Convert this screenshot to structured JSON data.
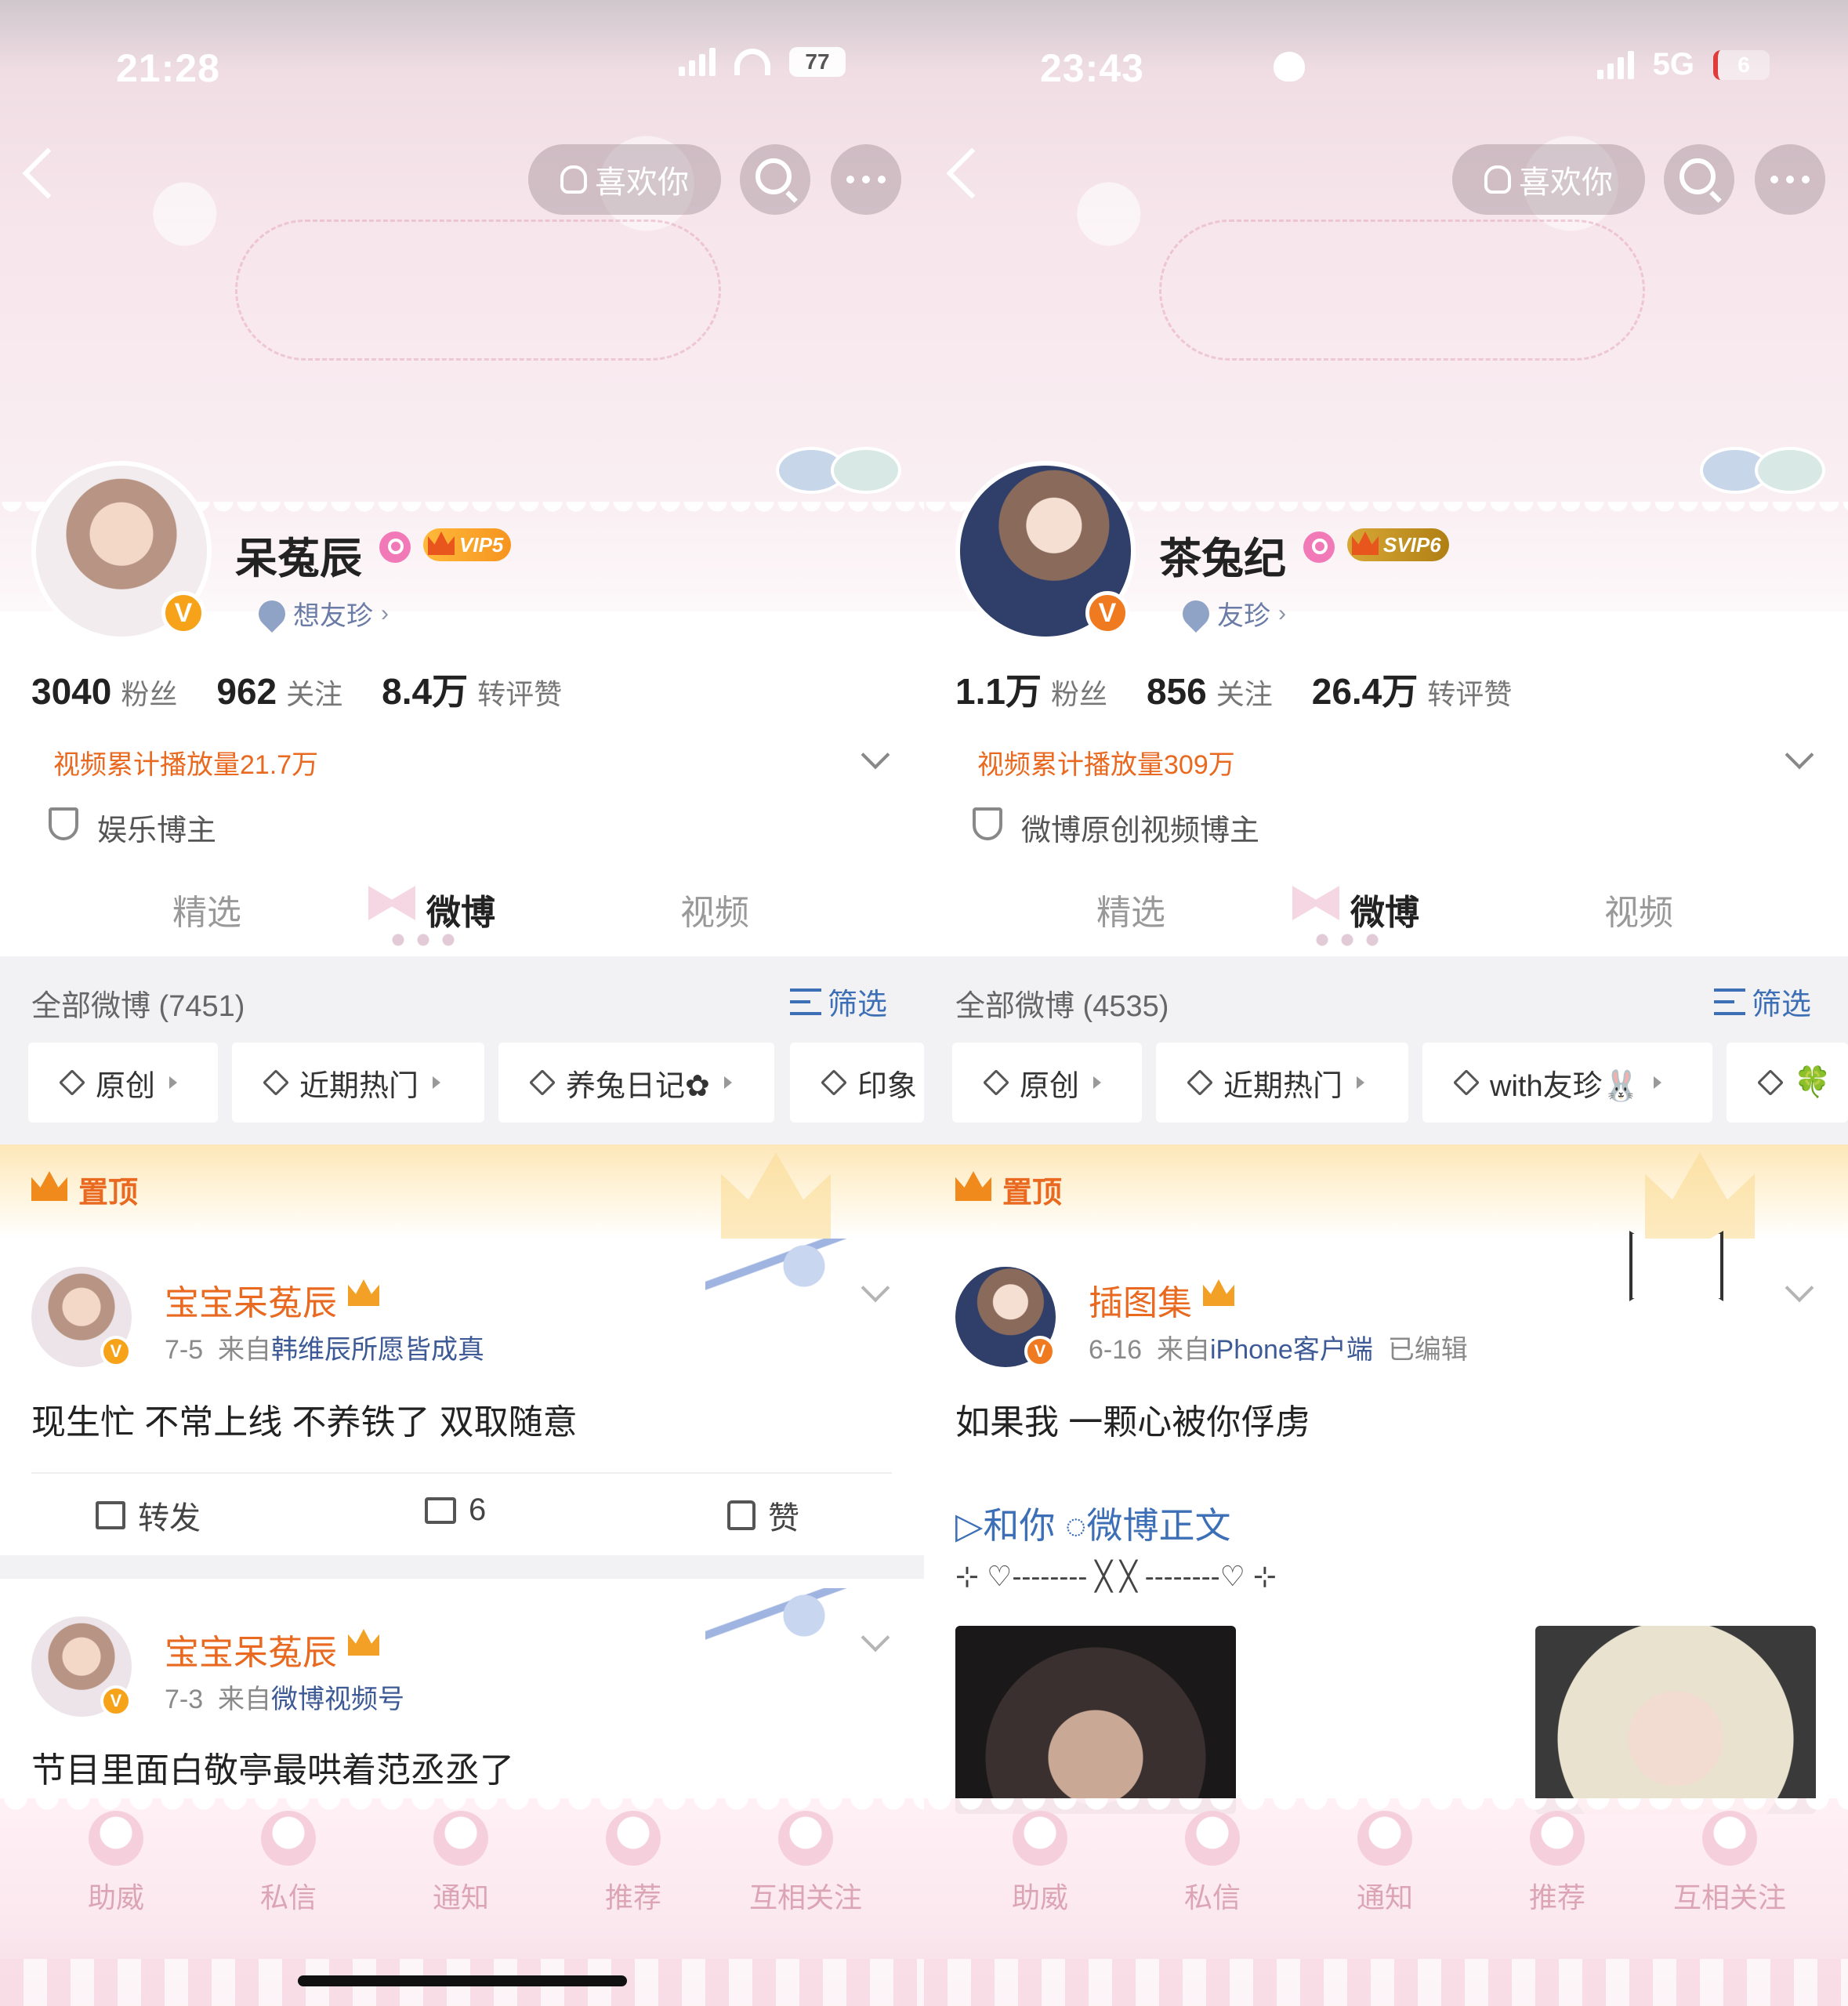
{
  "left": {
    "status": {
      "time": "21:28",
      "battery": "77"
    },
    "like_button": "喜欢你",
    "profile": {
      "name": "呆菟辰",
      "vip_label": "VIP5",
      "friend_label": "想友珍",
      "stats": [
        {
          "num": "3040",
          "label": "粉丝"
        },
        {
          "num": "962",
          "label": "关注"
        },
        {
          "num": "8.4万",
          "label": "转评赞"
        }
      ],
      "plays": "视频累计播放量21.7万",
      "role": "娱乐博主"
    },
    "tabs": [
      "精选",
      "微博",
      "视频"
    ],
    "all_count": "全部微博 (7451)",
    "filter_label": "筛选",
    "chips": [
      "原创",
      "近期热门",
      "养兔日记✿",
      "印象"
    ],
    "pinned_label": "置顶",
    "posts": [
      {
        "author": "宝宝呆菟辰",
        "date": "7-5",
        "from": "来自",
        "source": "韩维辰所愿皆成真",
        "text": "现生忙 不常上线 不养铁了 双取随意",
        "actions": {
          "repost": "转发",
          "comment": "6",
          "like": "赞"
        }
      },
      {
        "author": "宝宝呆菟辰",
        "date": "7-3",
        "from": "来自",
        "source": "微博视频号",
        "text": "节目里面白敬亭最哄着范丞丞了"
      }
    ],
    "bottom_nav": [
      "助威",
      "私信",
      "通知",
      "推荐",
      "互相关注"
    ]
  },
  "right": {
    "status": {
      "time": "23:43",
      "network": "5G",
      "battery": "6"
    },
    "like_button": "喜欢你",
    "profile": {
      "name": "茶兔纪",
      "vip_label": "SVIP6",
      "friend_label": "友珍",
      "stats": [
        {
          "num": "1.1万",
          "label": "粉丝"
        },
        {
          "num": "856",
          "label": "关注"
        },
        {
          "num": "26.4万",
          "label": "转评赞"
        }
      ],
      "plays": "视频累计播放量309万",
      "role": "微博原创视频博主"
    },
    "tabs": [
      "精选",
      "微博",
      "视频"
    ],
    "all_count": "全部微博 (4535)",
    "filter_label": "筛选",
    "chips": [
      "原创",
      "近期热门",
      "with友珍🐰",
      "🍀"
    ],
    "pinned_label": "置顶",
    "post": {
      "author": "插图集",
      "date": "6-16",
      "from": "来自",
      "source": "iPhone客户端",
      "edited": "已编辑",
      "text": "如果我 一颗心被你俘虏",
      "link_line": "▷和你 ◌微博正文",
      "deco_line": "⊹ ♡-------- ╳ ╳ --------♡ ⊹"
    },
    "bottom_nav": [
      "助威",
      "私信",
      "通知",
      "推荐",
      "互相关注"
    ]
  },
  "colors": {
    "accent_orange": "#e8691f",
    "link_blue": "#3d6fb6",
    "header_pink": "#f7e6ec"
  }
}
